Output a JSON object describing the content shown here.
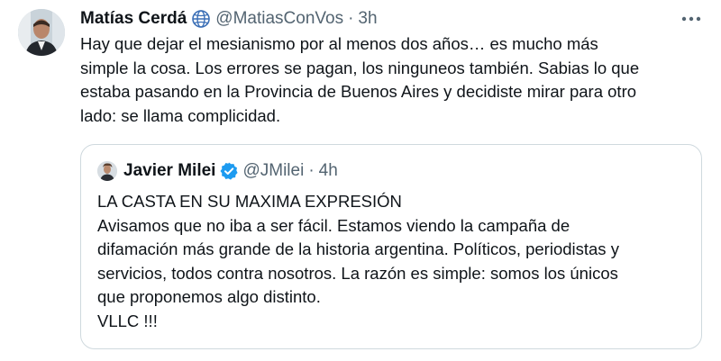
{
  "tweet": {
    "author_name": "Matías Cerdá",
    "handle": "@MatiasConVos",
    "separator": "·",
    "time": "3h",
    "lines": [
      "Hay que dejar el mesianismo por al menos dos años… es mucho más",
      "simple la cosa. Los errores se pagan, los ninguneos también. Sabias lo que",
      "estaba pasando en la Provincia de Buenos Aires y decidiste mirar para otro",
      "lado: se llama complicidad."
    ],
    "badge_icon": "globe-icon",
    "more_icon": "more-options-icon"
  },
  "quoted": {
    "author_name": "Javier Milei",
    "handle": "@JMilei",
    "separator": "·",
    "time": "4h",
    "badge_icon": "verified-badge-icon",
    "lines": [
      "LA CASTA EN SU MAXIMA EXPRESIÓN",
      "Avisamos que no iba a ser fácil. Estamos viendo la campaña de",
      "difamación más grande de la historia argentina. Políticos, periodistas y",
      "servicios, todos contra nosotros. La razón es simple: somos los únicos",
      "que proponemos algo distinto.",
      "VLLC !!!"
    ]
  },
  "colors": {
    "text_primary": "#0f1419",
    "text_secondary": "#536471",
    "verified_blue": "#1d9bf0",
    "border": "#cfd9de"
  }
}
